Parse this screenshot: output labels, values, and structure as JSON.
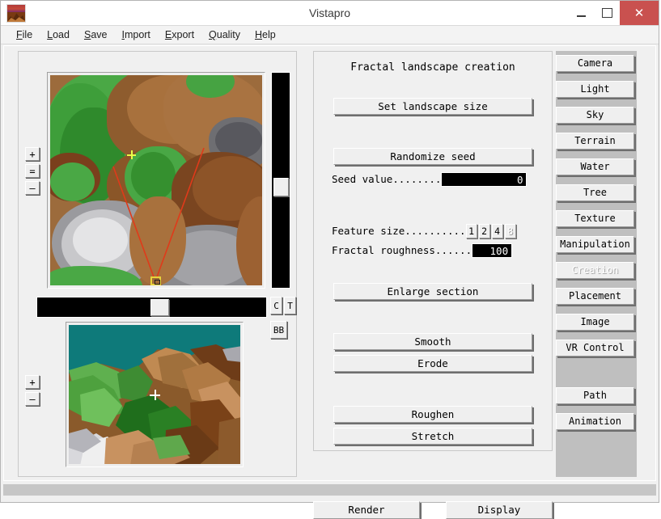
{
  "window": {
    "title": "Vistapro",
    "icon": "landscape-icon",
    "controls": {
      "minimize": "–",
      "maximize": "□",
      "close": "✕"
    }
  },
  "menu": {
    "items": [
      {
        "label": "File",
        "accel": "F"
      },
      {
        "label": "Load",
        "accel": "L"
      },
      {
        "label": "Save",
        "accel": "S"
      },
      {
        "label": "Import",
        "accel": "I"
      },
      {
        "label": "Export",
        "accel": "E"
      },
      {
        "label": "Quality",
        "accel": "Q"
      },
      {
        "label": "Help",
        "accel": "H"
      }
    ]
  },
  "left_panel": {
    "map_zoom": {
      "in": "+",
      "reset": "=",
      "out": "–"
    },
    "preview_zoom": {
      "in": "+",
      "out": "–"
    },
    "small_buttons": {
      "c": "C",
      "t": "T",
      "bb": "BB"
    }
  },
  "center_panel": {
    "title": "Fractal landscape creation",
    "set_landscape_size": "Set landscape size",
    "randomize_seed": "Randomize seed",
    "seed_label": "Seed value........",
    "seed_value": "0",
    "feature_size_label": "Feature size..........",
    "feature_size_options": [
      {
        "label": "1",
        "enabled": true
      },
      {
        "label": "2",
        "enabled": true
      },
      {
        "label": "4",
        "enabled": true
      },
      {
        "label": "8",
        "enabled": false
      }
    ],
    "roughness_label": "Fractal roughness......",
    "roughness_value": "100",
    "enlarge_section": "Enlarge section",
    "smooth": "Smooth",
    "erode": "Erode",
    "roughen": "Roughen",
    "stretch": "Stretch",
    "render": "Render",
    "display": "Display"
  },
  "right_panel": {
    "buttons": [
      {
        "label": "Camera",
        "enabled": true
      },
      {
        "label": "Light",
        "enabled": true
      },
      {
        "label": "Sky",
        "enabled": true
      },
      {
        "label": "Terrain",
        "enabled": true
      },
      {
        "label": "Water",
        "enabled": true
      },
      {
        "label": "Tree",
        "enabled": true
      },
      {
        "label": "Texture",
        "enabled": true
      },
      {
        "label": "Manipulation",
        "enabled": true
      },
      {
        "label": "Creation",
        "enabled": false
      },
      {
        "label": "Placement",
        "enabled": true
      },
      {
        "label": "Image",
        "enabled": true
      },
      {
        "label": "VR Control",
        "enabled": true
      }
    ],
    "buttons_lower": [
      {
        "label": "Path",
        "enabled": true
      },
      {
        "label": "Animation",
        "enabled": true
      }
    ]
  },
  "colors": {
    "close_button": "#c9514f",
    "panel_face": "#f0f0f0",
    "right_panel_bg": "#bfbfbf",
    "field_bg": "#000000",
    "map_water": "#0e7a7a",
    "map_grass": "#3e9e3a",
    "map_rock": "#9c6b3c",
    "map_snow": "#e0e0e0",
    "camera_marker": "#e8d23a",
    "view_cone": "#e03a1a"
  }
}
